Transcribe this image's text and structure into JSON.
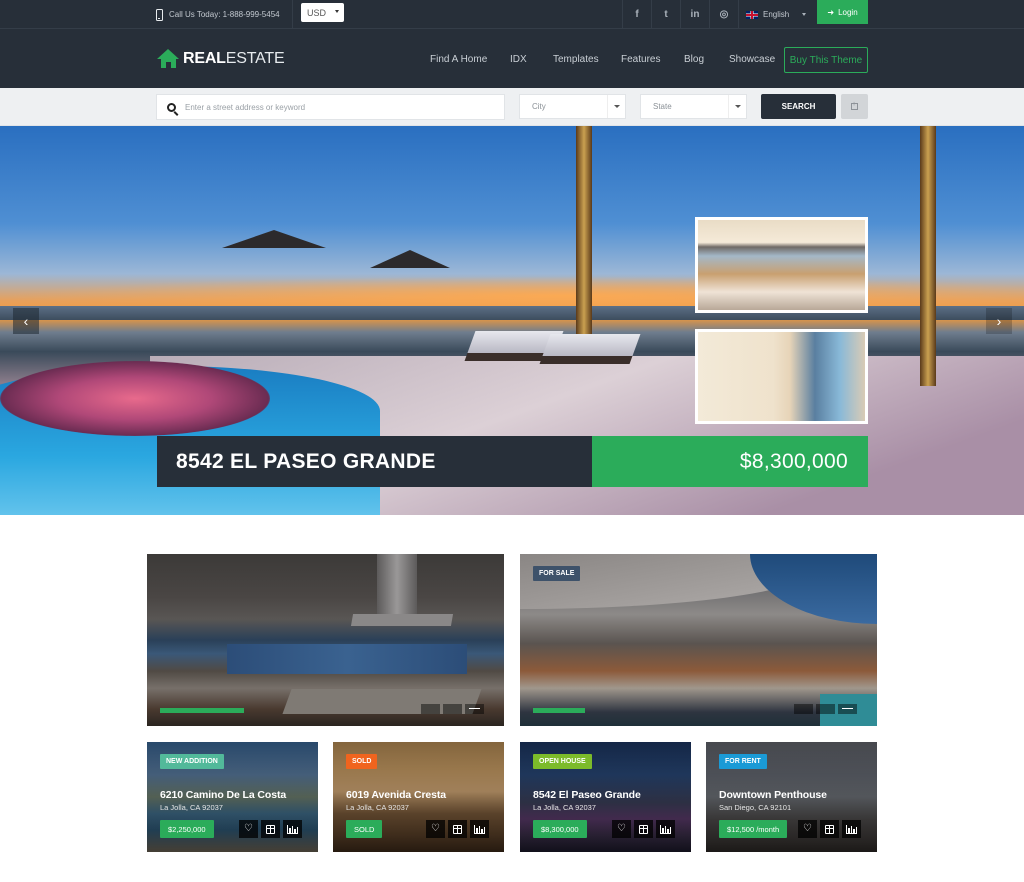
{
  "topbar": {
    "phone_label": "Call Us Today: 1-888-999-5454",
    "currency": "USD",
    "social": [
      {
        "name": "facebook",
        "glyph": "f"
      },
      {
        "name": "twitter",
        "glyph": "t"
      },
      {
        "name": "linkedin",
        "glyph": "in"
      },
      {
        "name": "instagram",
        "glyph": "◎"
      }
    ],
    "language": "English",
    "login_label": "Login",
    "login_glyph": "➜"
  },
  "header": {
    "logo_bold": "REAL",
    "logo_light": "ESTATE",
    "nav": [
      "Find A Home",
      "IDX",
      "Templates",
      "Features",
      "Blog",
      "Showcase"
    ],
    "cta_label": "Buy This Theme"
  },
  "search": {
    "placeholder": "Enter a street address or keyword",
    "city_placeholder": "City",
    "state_placeholder": "State",
    "button_label": "SEARCH"
  },
  "hero": {
    "title": "8542 EL PASEO GRANDE",
    "price": "$8,300,000",
    "prev_glyph": "‹",
    "next_glyph": "›"
  },
  "featured": [
    {
      "badge": "",
      "progress": 0.3
    },
    {
      "badge": "FOR SALE",
      "badge_color": "#3e526a",
      "progress": 0.3
    }
  ],
  "listings": [
    {
      "badge": "NEW ADDITION",
      "badge_color": "#52b99a",
      "title": "6210 Camino De La Costa",
      "location": "La Jolla, CA 92037",
      "price": "$2,250,000"
    },
    {
      "badge": "SOLD",
      "badge_color": "#f0641e",
      "title": "6019 Avenida Cresta",
      "location": "La Jolla, CA 92037",
      "price": "SOLD"
    },
    {
      "badge": "OPEN HOUSE",
      "badge_color": "#7cbb2a",
      "title": "8542 El Paseo Grande",
      "location": "La Jolla, CA 92037",
      "price": "$8,300,000"
    },
    {
      "badge": "FOR RENT",
      "badge_color": "#1a9ad6",
      "title": "Downtown Penthouse",
      "location": "San Diego, CA 92101",
      "price": "$12,500 /month"
    }
  ],
  "icons": {
    "favorite": "♡"
  },
  "colors": {
    "brand_green": "#2bac5a",
    "dark": "#272f39"
  }
}
